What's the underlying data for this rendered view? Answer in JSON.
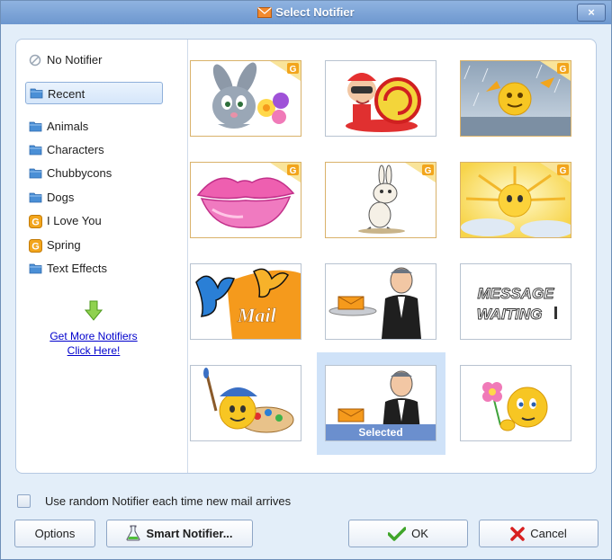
{
  "window": {
    "title": "Select Notifier",
    "close_label": "×"
  },
  "sidebar": {
    "no_notifier": "No Notifier",
    "recent": "Recent",
    "categories": [
      {
        "label": "Animals",
        "icon": "folder-icon"
      },
      {
        "label": "Characters",
        "icon": "folder-icon"
      },
      {
        "label": "Chubbycons",
        "icon": "folder-icon"
      },
      {
        "label": "Dogs",
        "icon": "folder-icon"
      },
      {
        "label": "I Love You",
        "icon": "g-badge-icon"
      },
      {
        "label": "Spring",
        "icon": "g-badge-icon"
      },
      {
        "label": "Text Effects",
        "icon": "folder-icon"
      }
    ],
    "more_line1": "Get More Notifiers",
    "more_line2": "Click Here!"
  },
  "grid": {
    "items": [
      {
        "name": "bunny-with-flowers",
        "badge": true
      },
      {
        "name": "snail-with-helmet",
        "badge": false
      },
      {
        "name": "smiley-in-storm",
        "badge": true
      },
      {
        "name": "pink-lips",
        "badge": true
      },
      {
        "name": "cartoon-rabbit",
        "badge": true
      },
      {
        "name": "sunshine-smiley",
        "badge": true
      },
      {
        "name": "butterflies-mail",
        "badge": false
      },
      {
        "name": "butler-with-letter",
        "badge": false
      },
      {
        "name": "message-waiting",
        "badge": false,
        "text_line1": "MESSAGE",
        "text_line2": "WAITING"
      },
      {
        "name": "painter-smiley",
        "badge": false
      },
      {
        "name": "butler-selected",
        "badge": false,
        "selected": true
      },
      {
        "name": "smiley-with-flower",
        "badge": false
      }
    ],
    "selected_label": "Selected"
  },
  "footer": {
    "random_label": "Use random Notifier each time new mail arrives",
    "options_label": "Options",
    "smart_label": "Smart Notifier...",
    "ok_label": "OK",
    "cancel_label": "Cancel"
  },
  "colors": {
    "folder": "#4a8fd6",
    "badge": "#f2a51c",
    "title_bg": "#7aa3d8",
    "selection": "#6b8fce"
  }
}
